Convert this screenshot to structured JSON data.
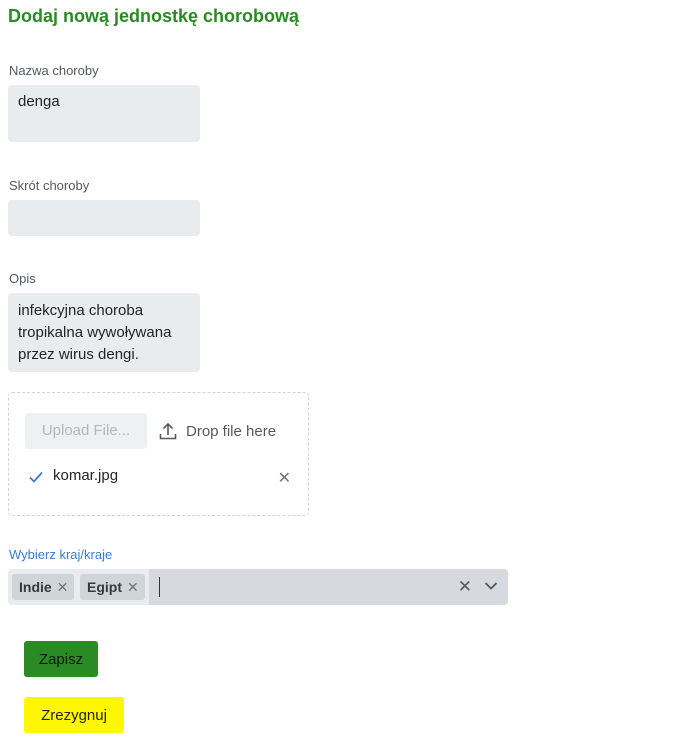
{
  "form": {
    "title": "Dodaj nową jednostkę chorobową",
    "name_label": "Nazwa choroby",
    "name_value": "denga",
    "abbr_label": "Skrót choroby",
    "abbr_value": "",
    "desc_label": "Opis",
    "desc_value": "infekcyjna choroba tropikalna wywoływana przez wirus dengi."
  },
  "upload": {
    "button_label": "Upload File...",
    "drop_label": "Drop file here",
    "files": [
      {
        "name": "komar.jpg",
        "status": "uploaded"
      }
    ],
    "remove_glyph": "✕"
  },
  "countries": {
    "label": "Wybierz kraj/kraje",
    "selected": [
      "Indie",
      "Egipt"
    ],
    "chip_remove_glyph": "✕",
    "clear_glyph": "✕"
  },
  "actions": {
    "save_label": "Zapisz",
    "cancel_label": "Zrezygnuj"
  },
  "colors": {
    "title": "#2a8a23",
    "save_button": "#2a8a23",
    "cancel_button": "#fff700",
    "select_label": "#3b7bd2",
    "check_icon": "#3b7bd2"
  },
  "icons": [
    "upload-icon",
    "check-icon",
    "close-icon",
    "chevron-down-icon"
  ]
}
